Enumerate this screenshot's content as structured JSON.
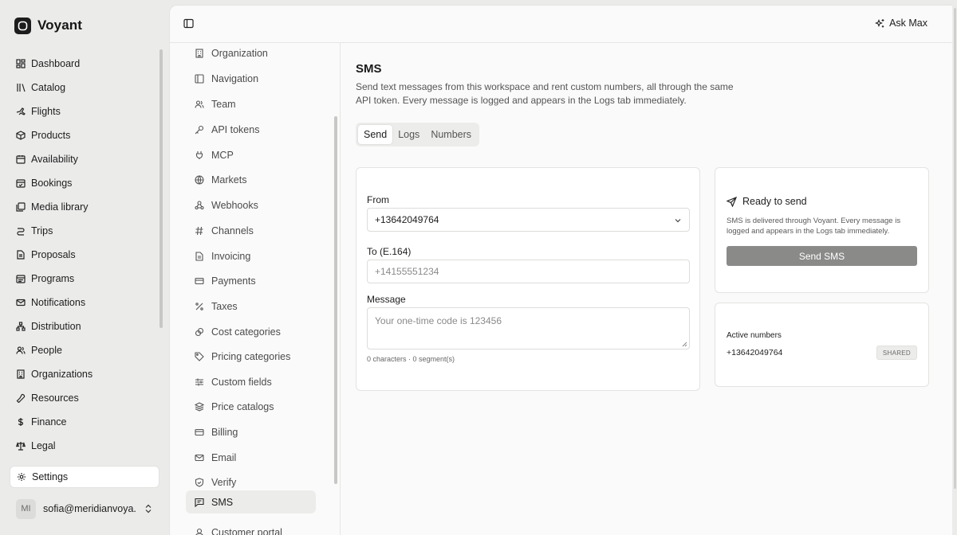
{
  "brand": {
    "name": "Voyant"
  },
  "sidebar": {
    "items": [
      {
        "label": "Dashboard",
        "icon": "dashboard-icon"
      },
      {
        "label": "Catalog",
        "icon": "library-icon"
      },
      {
        "label": "Flights",
        "icon": "plane-icon"
      },
      {
        "label": "Products",
        "icon": "package-icon"
      },
      {
        "label": "Availability",
        "icon": "calendar-icon"
      },
      {
        "label": "Bookings",
        "icon": "calendar-check-icon"
      },
      {
        "label": "Media library",
        "icon": "images-icon"
      },
      {
        "label": "Trips",
        "icon": "route-icon"
      },
      {
        "label": "Proposals",
        "icon": "file-text-icon"
      },
      {
        "label": "Programs",
        "icon": "calendar-range-icon"
      },
      {
        "label": "Notifications",
        "icon": "mail-icon"
      },
      {
        "label": "Distribution",
        "icon": "network-icon"
      },
      {
        "label": "People",
        "icon": "users-icon"
      },
      {
        "label": "Organizations",
        "icon": "building-icon"
      },
      {
        "label": "Resources",
        "icon": "wrench-icon"
      },
      {
        "label": "Finance",
        "icon": "dollar-icon"
      },
      {
        "label": "Legal",
        "icon": "scale-icon"
      }
    ],
    "active": {
      "label": "Settings",
      "icon": "gear-icon"
    },
    "user": {
      "initials": "MI",
      "email": "sofia@meridianvoya..."
    }
  },
  "topbar": {
    "ask_label": "Ask Max"
  },
  "settings_nav": {
    "items": [
      {
        "label": "Organization",
        "icon": "building-icon"
      },
      {
        "label": "Navigation",
        "icon": "panel-icon"
      },
      {
        "label": "Team",
        "icon": "users-icon"
      },
      {
        "label": "API tokens",
        "icon": "key-icon"
      },
      {
        "label": "MCP",
        "icon": "plug-icon"
      },
      {
        "label": "Markets",
        "icon": "globe-icon"
      },
      {
        "label": "Webhooks",
        "icon": "webhook-icon"
      },
      {
        "label": "Channels",
        "icon": "hash-icon"
      },
      {
        "label": "Invoicing",
        "icon": "file-text-icon"
      },
      {
        "label": "Payments",
        "icon": "credit-card-icon"
      },
      {
        "label": "Taxes",
        "icon": "percent-icon"
      },
      {
        "label": "Cost categories",
        "icon": "coins-icon"
      },
      {
        "label": "Pricing categories",
        "icon": "tag-icon"
      },
      {
        "label": "Custom fields",
        "icon": "sliders-icon"
      },
      {
        "label": "Price catalogs",
        "icon": "layers-icon"
      },
      {
        "label": "Billing",
        "icon": "credit-card-icon"
      },
      {
        "label": "Email",
        "icon": "mail-icon"
      },
      {
        "label": "Verify",
        "icon": "shield-check-icon"
      },
      {
        "label": "SMS",
        "icon": "message-square-icon"
      },
      {
        "label": "Customer portal",
        "icon": "user-icon"
      }
    ],
    "active_index": 18
  },
  "page": {
    "title": "SMS",
    "description": "Send text messages from this workspace and rent custom numbers, all through the same API token. Every message is logged and appears in the Logs tab immediately.",
    "tabs": [
      "Send",
      "Logs",
      "Numbers"
    ],
    "active_tab": "Send"
  },
  "form": {
    "from_label": "From",
    "from_value": "+13642049764",
    "to_label": "To (E.164)",
    "to_placeholder": "+14155551234",
    "message_label": "Message",
    "message_placeholder": "Your one-time code is 123456",
    "hint": "0 characters · 0 segment(s)"
  },
  "ready": {
    "title": "Ready to send",
    "description": "SMS is delivered through Voyant. Every message is logged and appears in the Logs tab immediately.",
    "button": "Send SMS"
  },
  "numbers": {
    "title": "Active numbers",
    "items": [
      {
        "number": "+13642049764",
        "badge": "SHARED"
      }
    ]
  }
}
